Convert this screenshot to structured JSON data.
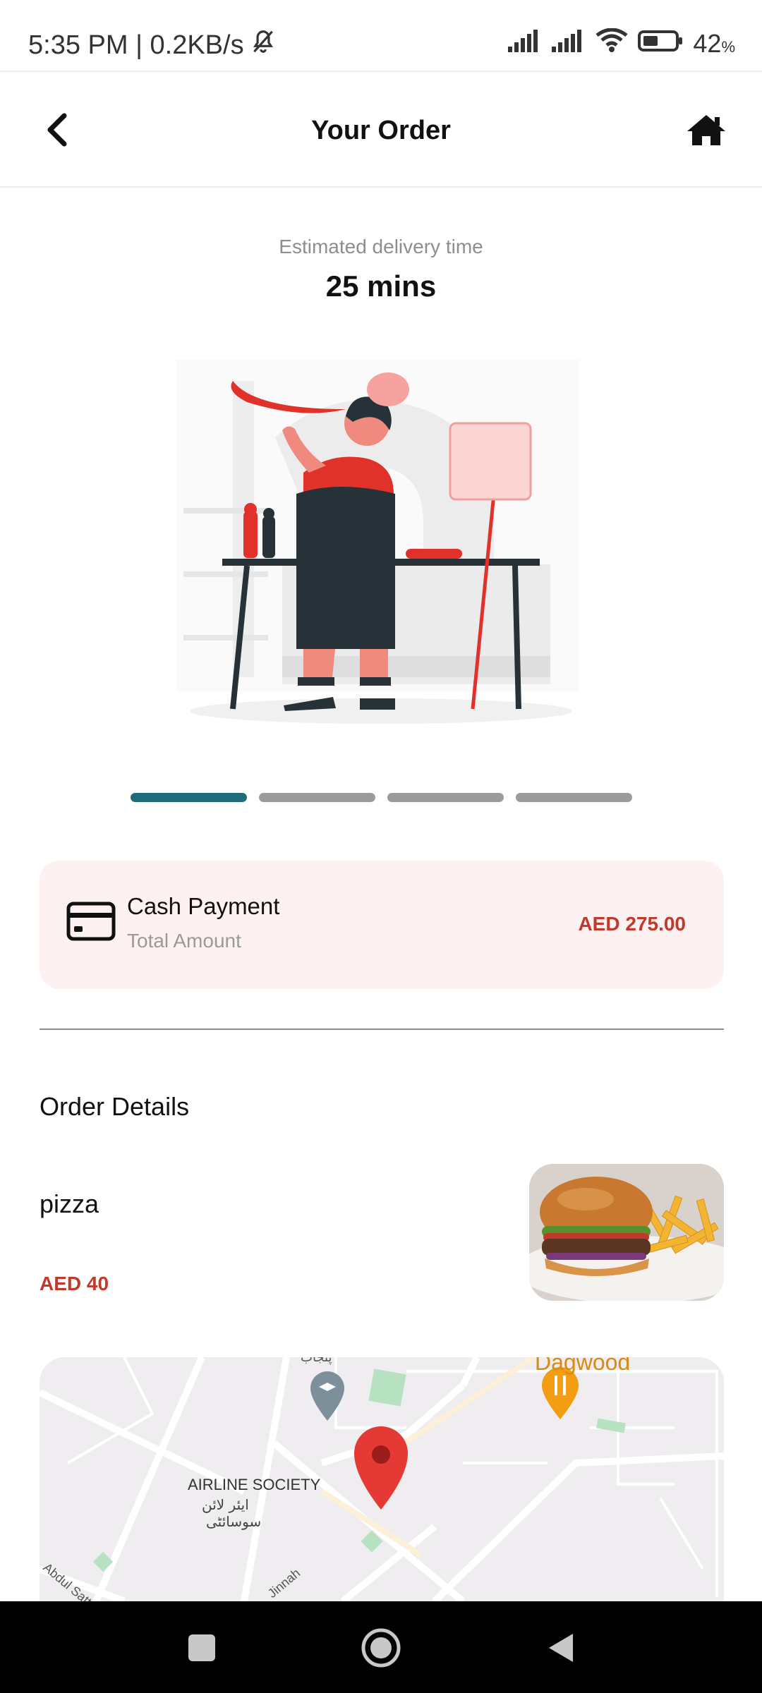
{
  "status_bar": {
    "time_speed": "5:35 PM | 0.2KB/s",
    "battery_percent": "42",
    "battery_unit": "%"
  },
  "header": {
    "title": "Your Order"
  },
  "delivery": {
    "label": "Estimated delivery time",
    "value": "25 mins"
  },
  "progress": {
    "steps_total": 4,
    "current_step": 1
  },
  "payment": {
    "method": "Cash Payment",
    "subtitle": "Total Amount",
    "amount": "AED 275.00"
  },
  "order_details": {
    "title": "Order Details",
    "items": [
      {
        "name": "pizza",
        "price": "AED 40"
      }
    ]
  },
  "map": {
    "labels": {
      "area_en": "AIRLINE SOCIETY",
      "area_ur_1": "ایئر لائن",
      "area_ur_2": "سوسائٹی",
      "place_top_right": "Dagwood",
      "place_top": "پنجاب",
      "road_left": "Abdul Satta",
      "road_bottom": "Jinnah"
    }
  },
  "colors": {
    "accent_teal": "#1f6b7a",
    "price_red": "#c0392b",
    "card_bg": "#fdf1f1"
  }
}
